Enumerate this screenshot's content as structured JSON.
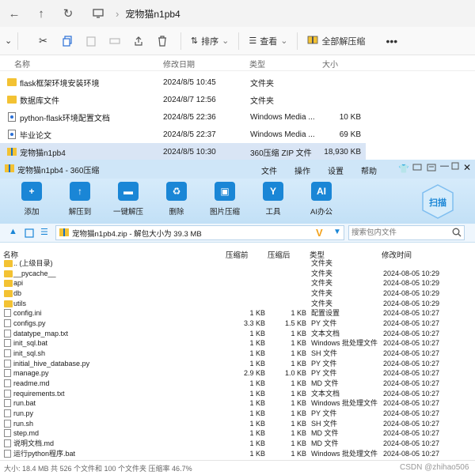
{
  "explorer": {
    "path_folder": "宠物猫n1pb4",
    "toolbar": {
      "sort": "排序",
      "view": "查看",
      "extract_all": "全部解压缩"
    },
    "headers": {
      "name": "名称",
      "modified": "修改日期",
      "type": "类型",
      "size": "大小"
    },
    "files": [
      {
        "name": "flask框架环境安装环境",
        "date": "2024/8/5 10:45",
        "type": "文件夹",
        "size": "",
        "kind": "folder"
      },
      {
        "name": "数据库文件",
        "date": "2024/8/7 12:56",
        "type": "文件夹",
        "size": "",
        "kind": "folder"
      },
      {
        "name": "python-flask环境配置文档",
        "date": "2024/8/5 22:36",
        "type": "Windows Media ...",
        "size": "10 KB",
        "kind": "doc"
      },
      {
        "name": "毕业论文",
        "date": "2024/8/5 22:37",
        "type": "Windows Media ...",
        "size": "69 KB",
        "kind": "doc"
      },
      {
        "name": "宠物猫n1pb4",
        "date": "2024/8/5 10:30",
        "type": "360压缩 ZIP 文件",
        "size": "18,930 KB",
        "kind": "zip",
        "selected": true
      }
    ]
  },
  "zip": {
    "title": "宠物猫n1pb4 - 360压缩",
    "menu": [
      "文件",
      "操作",
      "设置",
      "帮助"
    ],
    "ribbon": [
      {
        "label": "添加",
        "icon": "add-icon",
        "color": "#1a86d6"
      },
      {
        "label": "解压到",
        "icon": "extract-icon",
        "color": "#1a86d6"
      },
      {
        "label": "一键解压",
        "icon": "one-click-extract-icon",
        "color": "#1a86d6"
      },
      {
        "label": "删除",
        "icon": "delete-icon",
        "color": "#1a86d6"
      },
      {
        "label": "图片压缩",
        "icon": "image-compress-icon",
        "color": "#1a86d6"
      },
      {
        "label": "工具",
        "icon": "tools-icon",
        "color": "#1a86d6"
      },
      {
        "label": "AI办公",
        "icon": "ai-office-icon",
        "color": "#1a86d6"
      }
    ],
    "scan_label": "扫描",
    "address": "宠物猫n1pb4.zip - 解包大小为 39.3 MB",
    "search_placeholder": "搜索包内文件",
    "headers": {
      "name": "名称",
      "compressed": "压缩前",
      "packed": "压缩后",
      "type": "类型",
      "modified": "修改时间"
    },
    "files": [
      {
        "name": ".. (上级目录)",
        "c": "",
        "p": "",
        "type": "文件夹",
        "date": "",
        "kind": "folder"
      },
      {
        "name": "__pycache__",
        "c": "",
        "p": "",
        "type": "文件夹",
        "date": "2024-08-05 10:29",
        "kind": "folder"
      },
      {
        "name": "api",
        "c": "",
        "p": "",
        "type": "文件夹",
        "date": "2024-08-05 10:29",
        "kind": "folder"
      },
      {
        "name": "db",
        "c": "",
        "p": "",
        "type": "文件夹",
        "date": "2024-08-05 10:29",
        "kind": "folder"
      },
      {
        "name": "utils",
        "c": "",
        "p": "",
        "type": "文件夹",
        "date": "2024-08-05 10:29",
        "kind": "folder"
      },
      {
        "name": "config.ini",
        "c": "1 KB",
        "p": "1 KB",
        "type": "配置设置",
        "date": "2024-08-05 10:27",
        "kind": "file"
      },
      {
        "name": "configs.py",
        "c": "3.3 KB",
        "p": "1.5 KB",
        "type": "PY 文件",
        "date": "2024-08-05 10:27",
        "kind": "file"
      },
      {
        "name": "datatype_map.txt",
        "c": "1 KB",
        "p": "1 KB",
        "type": "文本文档",
        "date": "2024-08-05 10:27",
        "kind": "file"
      },
      {
        "name": "init_sql.bat",
        "c": "1 KB",
        "p": "1 KB",
        "type": "Windows 批处理文件",
        "date": "2024-08-05 10:27",
        "kind": "file"
      },
      {
        "name": "init_sql.sh",
        "c": "1 KB",
        "p": "1 KB",
        "type": "SH 文件",
        "date": "2024-08-05 10:27",
        "kind": "file"
      },
      {
        "name": "initial_hive_database.py",
        "c": "1 KB",
        "p": "1 KB",
        "type": "PY 文件",
        "date": "2024-08-05 10:27",
        "kind": "file"
      },
      {
        "name": "manage.py",
        "c": "2.9 KB",
        "p": "1.0 KB",
        "type": "PY 文件",
        "date": "2024-08-05 10:27",
        "kind": "file"
      },
      {
        "name": "readme.md",
        "c": "1 KB",
        "p": "1 KB",
        "type": "MD 文件",
        "date": "2024-08-05 10:27",
        "kind": "file"
      },
      {
        "name": "requirements.txt",
        "c": "1 KB",
        "p": "1 KB",
        "type": "文本文档",
        "date": "2024-08-05 10:27",
        "kind": "file"
      },
      {
        "name": "run.bat",
        "c": "1 KB",
        "p": "1 KB",
        "type": "Windows 批处理文件",
        "date": "2024-08-05 10:27",
        "kind": "file"
      },
      {
        "name": "run.py",
        "c": "1 KB",
        "p": "1 KB",
        "type": "PY 文件",
        "date": "2024-08-05 10:27",
        "kind": "file"
      },
      {
        "name": "run.sh",
        "c": "1 KB",
        "p": "1 KB",
        "type": "SH 文件",
        "date": "2024-08-05 10:27",
        "kind": "file"
      },
      {
        "name": "step.md",
        "c": "1 KB",
        "p": "1 KB",
        "type": "MD 文件",
        "date": "2024-08-05 10:27",
        "kind": "file"
      },
      {
        "name": "说明文档.md",
        "c": "1 KB",
        "p": "1 KB",
        "type": "MD 文件",
        "date": "2024-08-05 10:27",
        "kind": "file"
      },
      {
        "name": "运行python程序.bat",
        "c": "1 KB",
        "p": "1 KB",
        "type": "Windows 批处理文件",
        "date": "2024-08-05 10:27",
        "kind": "file"
      }
    ],
    "status": "大小: 18.4 MB 共 526 个文件和 100 个文件夹 压缩率 46.7%",
    "watermark": "CSDN @zhihao506"
  }
}
